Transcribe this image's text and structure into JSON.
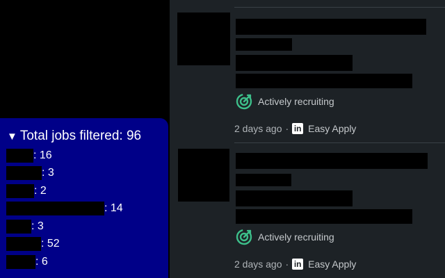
{
  "filter_panel": {
    "summary_label": "Total jobs filtered: 96",
    "caret": "▼",
    "rows": [
      {
        "count_text": ": 16"
      },
      {
        "count_text": ": 3"
      },
      {
        "count_text": ": 2"
      },
      {
        "count_text": ": 14"
      },
      {
        "count_text": ": 3"
      },
      {
        "count_text": ": 52"
      },
      {
        "count_text": ": 6"
      }
    ],
    "background_color": "#000088"
  },
  "jobs": [
    {
      "status_text": "Actively recruiting",
      "posted": "2 days ago",
      "separator": "·",
      "apply_label": "Easy Apply",
      "apply_icon": "linkedin-icon",
      "status_icon": "target-icon"
    },
    {
      "status_text": "Actively recruiting",
      "posted": "2 days ago",
      "separator": "·",
      "apply_label": "Easy Apply",
      "apply_icon": "linkedin-icon",
      "status_icon": "target-icon"
    }
  ],
  "colors": {
    "accent_green": "#3dbf8a",
    "list_background": "#1d2226"
  }
}
